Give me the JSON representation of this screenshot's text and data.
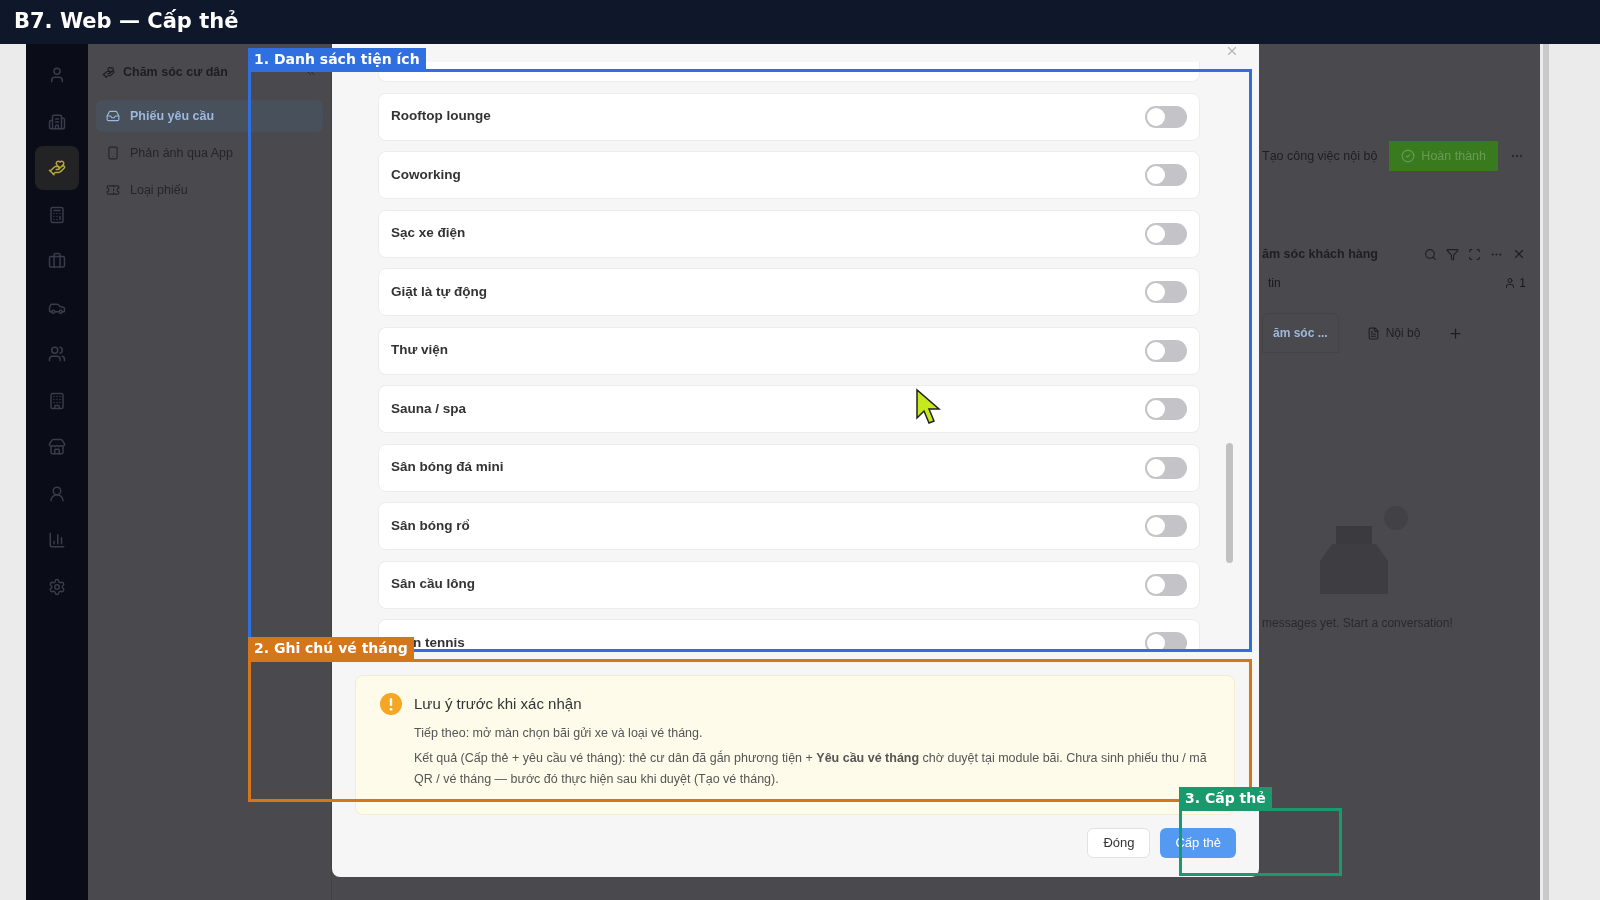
{
  "header": {
    "title": "B7. Web — Cấp thẻ"
  },
  "nav_rail": {
    "items": [
      {
        "selected": false
      },
      {
        "selected": false
      },
      {
        "selected": true
      },
      {
        "selected": false
      },
      {
        "selected": false
      },
      {
        "selected": false
      },
      {
        "selected": false
      },
      {
        "selected": false
      },
      {
        "selected": false
      },
      {
        "selected": false
      },
      {
        "selected": false
      },
      {
        "selected": false
      }
    ]
  },
  "sidebar": {
    "title": "Chăm sóc cư dân",
    "items": [
      {
        "label": "Phiếu yêu cầu",
        "selected": true
      },
      {
        "label": "Phản ánh qua App",
        "selected": false
      },
      {
        "label": "Loại phiếu",
        "selected": false
      }
    ]
  },
  "modal": {
    "amenities": [
      {
        "label": "Rooftop lounge",
        "on": false
      },
      {
        "label": "Coworking",
        "on": false
      },
      {
        "label": "Sạc xe điện",
        "on": false
      },
      {
        "label": "Giặt là tự động",
        "on": false
      },
      {
        "label": "Thư viện",
        "on": false
      },
      {
        "label": "Sauna / spa",
        "on": false
      },
      {
        "label": "Sân bóng đá mini",
        "on": false
      },
      {
        "label": "Sân bóng rổ",
        "on": false
      },
      {
        "label": "Sân cầu lông",
        "on": false
      },
      {
        "label": "n tennis",
        "on": false
      }
    ],
    "note": {
      "title": "Lưu ý trước khi xác nhận",
      "lines": [
        "Tiếp theo: mở màn chọn bãi gửi xe và loại vé tháng.",
        "Kết quả (Cấp thẻ + yêu cầu vé tháng): thẻ cư dân đã gắn phương tiện + **Yêu cầu vé tháng** chờ duyệt tại module bãi. Chưa sinh phiếu thu / mã QR / vé tháng — bước đó thực hiện sau khi duyệt (Tạo vé tháng)."
      ]
    },
    "buttons": [
      {
        "label": "Đóng",
        "kind": "default"
      },
      {
        "label": "Cấp thẻ",
        "kind": "primary"
      }
    ]
  },
  "background_panel": {
    "secondary_action": "Tạo công việc nội bộ",
    "primary_action": "Hoàn thành",
    "chat": {
      "title": "ăm sóc khách hàng",
      "subtitle": "tin",
      "member_count": "1",
      "tabs": [
        {
          "label": "ăm sóc ...",
          "selected": true
        },
        {
          "label": "Nội bộ",
          "selected": false
        }
      ],
      "empty_text": "messages yet. Start a conversation!"
    }
  },
  "annotations": [
    {
      "label": "1. Danh sách tiện ích",
      "color": "#2f6fe0"
    },
    {
      "label": "2. Ghi chú vé tháng",
      "color": "#d4761a"
    },
    {
      "label": "3. Cấp thẻ",
      "color": "#1a9a6c"
    }
  ]
}
